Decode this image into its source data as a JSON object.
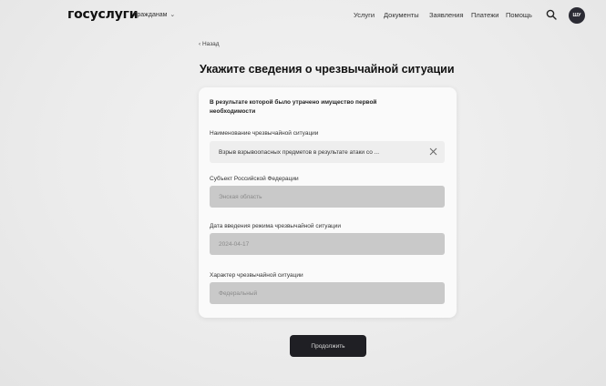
{
  "header": {
    "logo": "госуслуги",
    "audience": "Гражданам",
    "nav": [
      "Услуги",
      "Документы",
      "Заявления",
      "Платежи",
      "Помощь"
    ],
    "avatar_initials": "ШУ"
  },
  "back_link": "‹ Назад",
  "page_title": "Укажите сведения о чрезвычайной ситуации",
  "card": {
    "question": "В результате которой было утрачено имущество первой необходимости",
    "fields": [
      {
        "label": "Наименование чрезвычайной ситуации",
        "value": "Взрыв взрывоопасных предметов в результате атаки со ..."
      },
      {
        "label": "Субъект Российской Федерации",
        "value": "Энская область"
      },
      {
        "label": "Дата введения режима чрезвычайной ситуации",
        "value": "2024-04-17"
      },
      {
        "label": "Характер чрезвычайной ситуации",
        "value": "Федеральный"
      }
    ]
  },
  "submit_label": "Продолжить"
}
